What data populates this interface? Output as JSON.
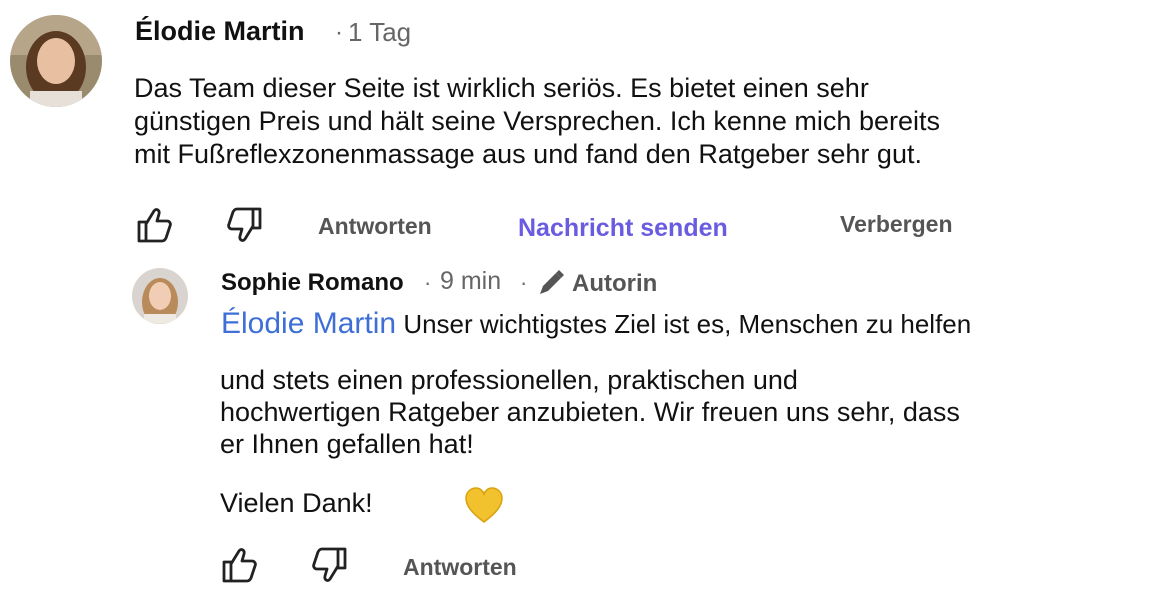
{
  "comment": {
    "author": "Élodie Martin",
    "time": "1 Tag",
    "separator": "·",
    "text_lines": [
      "Das Team dieser Seite ist wirklich seriös. Es bietet einen sehr",
      "günstigen Preis und hält seine Versprechen. Ich kenne mich bereits",
      "mit Fußreflexzonenmassage aus und fand den Ratgeber sehr gut."
    ],
    "actions": {
      "like_icon": "thumbs-up-icon",
      "dislike_icon": "thumbs-down-icon",
      "reply": "Antworten",
      "message": "Nachricht senden",
      "hide": "Verbergen"
    }
  },
  "reply": {
    "author": "Sophie Romano",
    "time": "9 min",
    "separator": "·",
    "role_icon": "pencil-icon",
    "role": "Autorin",
    "mention": "Élodie Martin",
    "first_line": "Unser wichtigstes Ziel ist es, Menschen zu helfen",
    "text_lines": [
      "und stets einen professionellen, praktischen und",
      "hochwertigen Ratgeber anzubieten. Wir freuen uns sehr, dass",
      "er Ihnen gefallen hat!"
    ],
    "closing": "Vielen Dank!",
    "closing_icon": "yellow-heart-icon",
    "actions": {
      "like_icon": "thumbs-up-icon",
      "dislike_icon": "thumbs-down-icon",
      "reply": "Antworten"
    }
  },
  "colors": {
    "mention": "#3d6fd6",
    "message_action": "#6a5ce0",
    "heart": "#f2c12e",
    "meta": "#666666"
  }
}
